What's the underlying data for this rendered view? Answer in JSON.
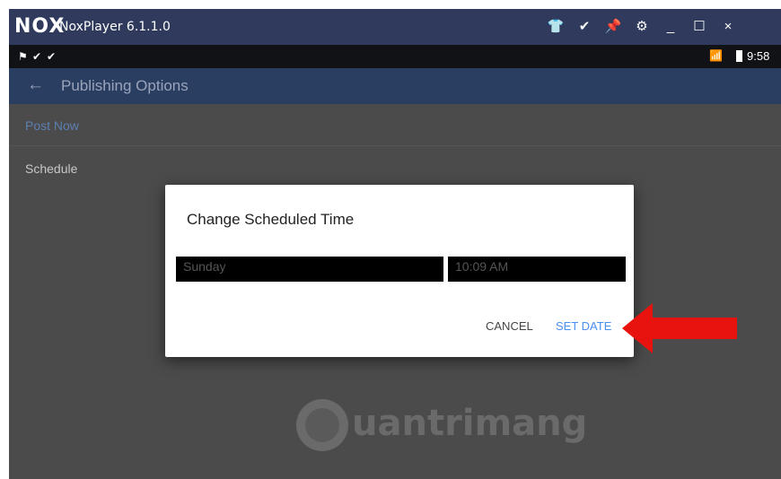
{
  "emulator": {
    "logo": "NOX",
    "title": "NoxPlayer 6.1.1.0",
    "buttons": {
      "shirt": "👕",
      "chevron": "✔",
      "pin": "📌",
      "gear": "⚙",
      "minimize": "_",
      "maximize": "☐",
      "close": "×"
    }
  },
  "status_bar": {
    "left_icons": [
      "⚑",
      "✔",
      "✔"
    ],
    "signal": "📶",
    "time": "9:58"
  },
  "app_bar": {
    "back_icon": "←",
    "title": "Publishing Options"
  },
  "options": [
    {
      "label": "Post Now"
    },
    {
      "label": "Schedule"
    }
  ],
  "dialog": {
    "title": "Change Scheduled Time",
    "date_value": "Sunday",
    "time_value": "10:09 AM",
    "cancel_label": "CANCEL",
    "set_date_label": "SET DATE"
  },
  "watermark": {
    "text": "uantrimang"
  },
  "colors": {
    "nox_titlebar": "#2f3a5c",
    "app_bar": "#2a3e62",
    "accent": "#4a8ef0",
    "arrow": "#e8130e"
  }
}
